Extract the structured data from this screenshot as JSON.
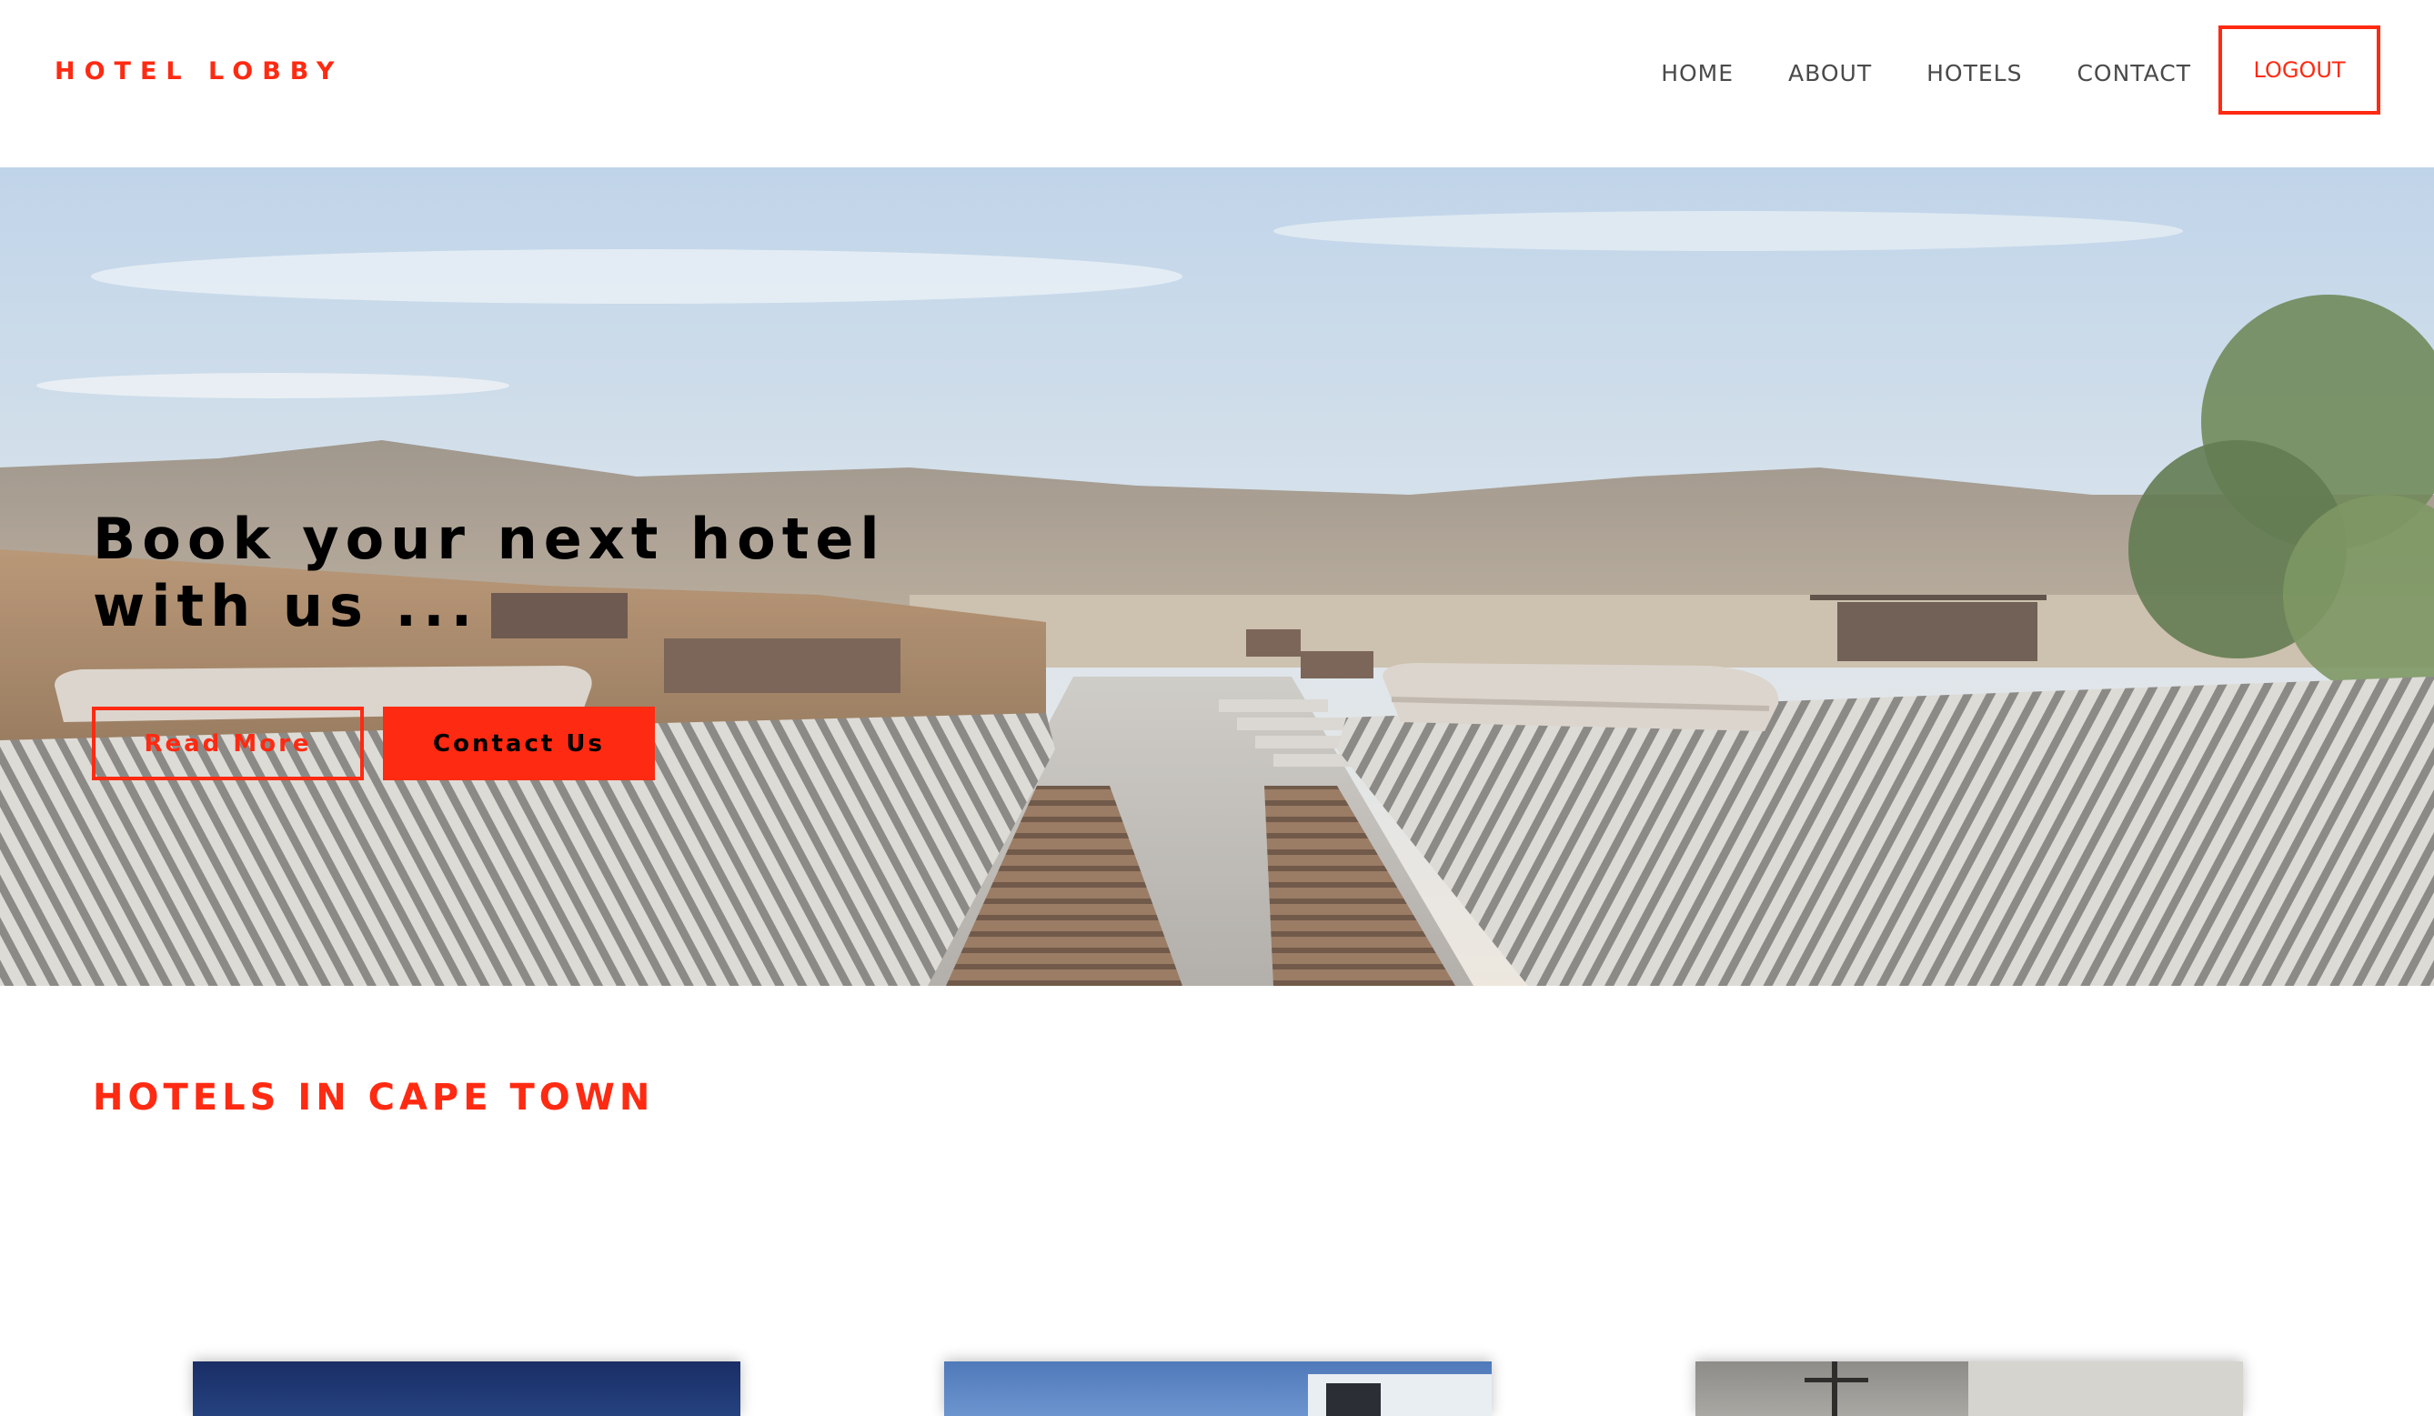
{
  "header": {
    "brand": "HOTEL LOBBY",
    "nav": [
      "HOME",
      "ABOUT",
      "HOTELS",
      "CONTACT"
    ],
    "logout_label": "LOGOUT"
  },
  "hero": {
    "title": "Book your next hotel with us ...",
    "read_more_label": "Read More",
    "contact_label": "Contact Us",
    "image": "resort-pool-loungers-desert-mountains"
  },
  "section": {
    "title": "HOTELS IN CAPE TOWN"
  },
  "cards": [
    {
      "image": "hotel-photo-dark-blue-sky"
    },
    {
      "image": "hotel-photo-modern-building"
    },
    {
      "image": "hotel-photo-interior-lamp"
    }
  ],
  "colors": {
    "accent": "#ff2a12",
    "nav_text": "#4a4a4a",
    "hero_text": "#000000"
  }
}
